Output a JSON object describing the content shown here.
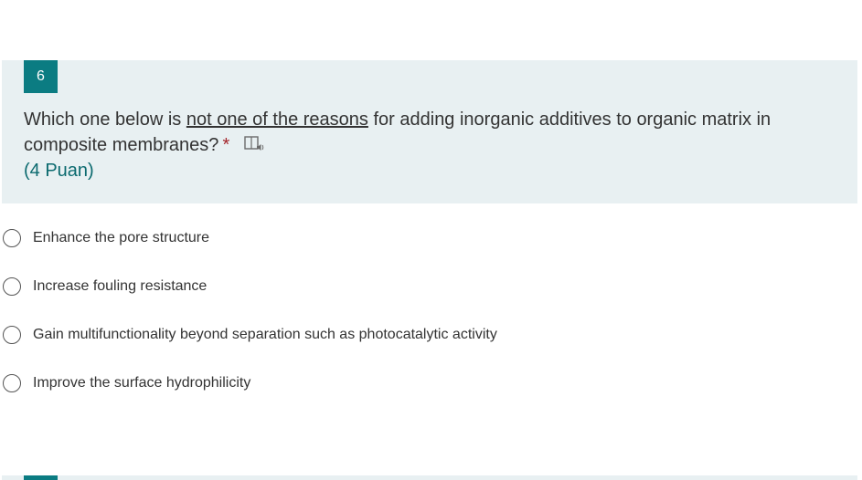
{
  "question": {
    "number": "6",
    "text_before": "Which one below is ",
    "text_underlined": "not one of the reasons",
    "text_after": " for adding inorganic additives to organic matrix in composite membranes?",
    "required_marker": "*",
    "points": "(4 Puan)",
    "icon": "immersive-reader-icon"
  },
  "options": [
    {
      "label": "Enhance the pore structure",
      "selected": false
    },
    {
      "label": "Increase fouling resistance",
      "selected": false
    },
    {
      "label": "Gain multifunctionality beyond separation such as photocatalytic activity",
      "selected": false
    },
    {
      "label": "Improve the surface hydrophilicity",
      "selected": false
    }
  ],
  "colors": {
    "accent": "#0b7c82",
    "card_background": "#e8f0f2",
    "required": "#a4262c",
    "points": "#0b6a6f"
  }
}
